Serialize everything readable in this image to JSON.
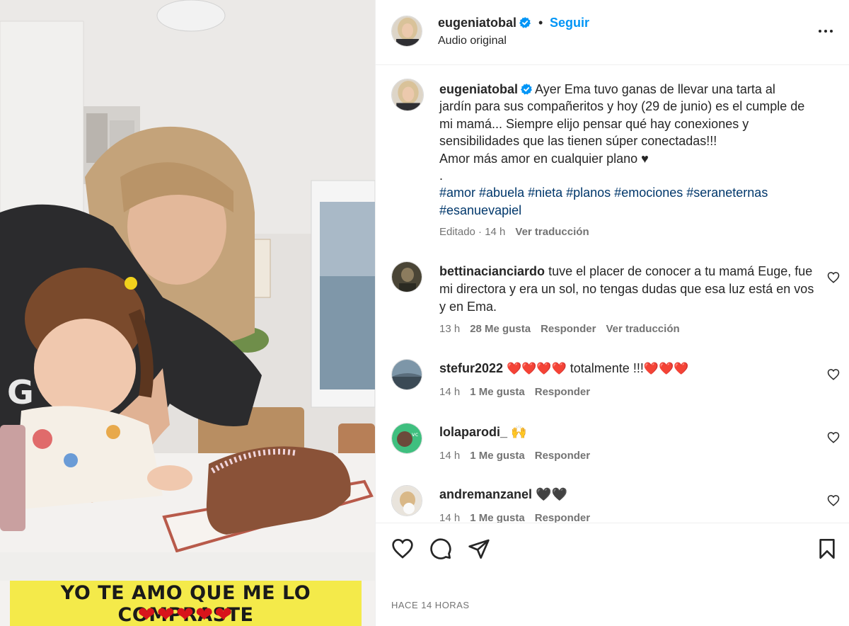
{
  "post": {
    "username": "eugeniatobal",
    "follow_label": "Seguir",
    "separator": "•",
    "audio": "Audio original",
    "more_icon": "more-horizontal-icon",
    "media_caption": "YO TE AMO QUE ME LO COMPRASTE",
    "media_hearts": "❤❤❤❤❤",
    "time_ago": "HACE 14 HORAS"
  },
  "caption": {
    "username": "eugeniatobal",
    "text": "Ayer Ema tuvo ganas de llevar una tarta al jardín para sus compañeritos y hoy (29 de junio) es el cumple de mi mamá... Siempre elijo pensar qué hay conexiones y sensibilidades que las tienen súper conectadas!!!",
    "line2": "Amor más amor en cualquier plano ♥",
    "line3": ".",
    "hashtags": "#amor #abuela #nieta #planos #emociones #seraneternas #esanuevapiel",
    "edited": "Editado · 14 h",
    "translate": "Ver traducción"
  },
  "comments": [
    {
      "username": "bettinacianciardo",
      "text": "tuve el placer de conocer a tu mamá Euge, fue mi directora y era un sol, no tengas dudas que esa luz está en vos y en Ema.",
      "time": "13 h",
      "likes": "28 Me gusta",
      "reply": "Responder",
      "translate": "Ver traducción"
    },
    {
      "username": "stefur2022",
      "hearts_before": "❤️❤️❤️❤️",
      "text": "totalmente !!!",
      "hearts_after": "❤️❤️❤️",
      "time": "14 h",
      "likes": "1 Me gusta",
      "reply": "Responder"
    },
    {
      "username": "lolaparodi_",
      "text": "🙌",
      "time": "14 h",
      "likes": "1 Me gusta",
      "reply": "Responder"
    },
    {
      "username": "andremanzanel",
      "text": "🖤🖤",
      "time": "14 h",
      "likes": "1 Me gusta",
      "reply": "Responder"
    }
  ],
  "actions": {
    "like_icon": "heart-icon",
    "comment_icon": "comment-icon",
    "share_icon": "send-icon",
    "save_icon": "bookmark-icon"
  },
  "colors": {
    "link_blue": "#0095f6",
    "verified_blue": "#0095f6",
    "hashtag": "#00376b",
    "muted": "#737373",
    "caption_band": "#f4ea4a",
    "heart_red": "#e0161f"
  }
}
